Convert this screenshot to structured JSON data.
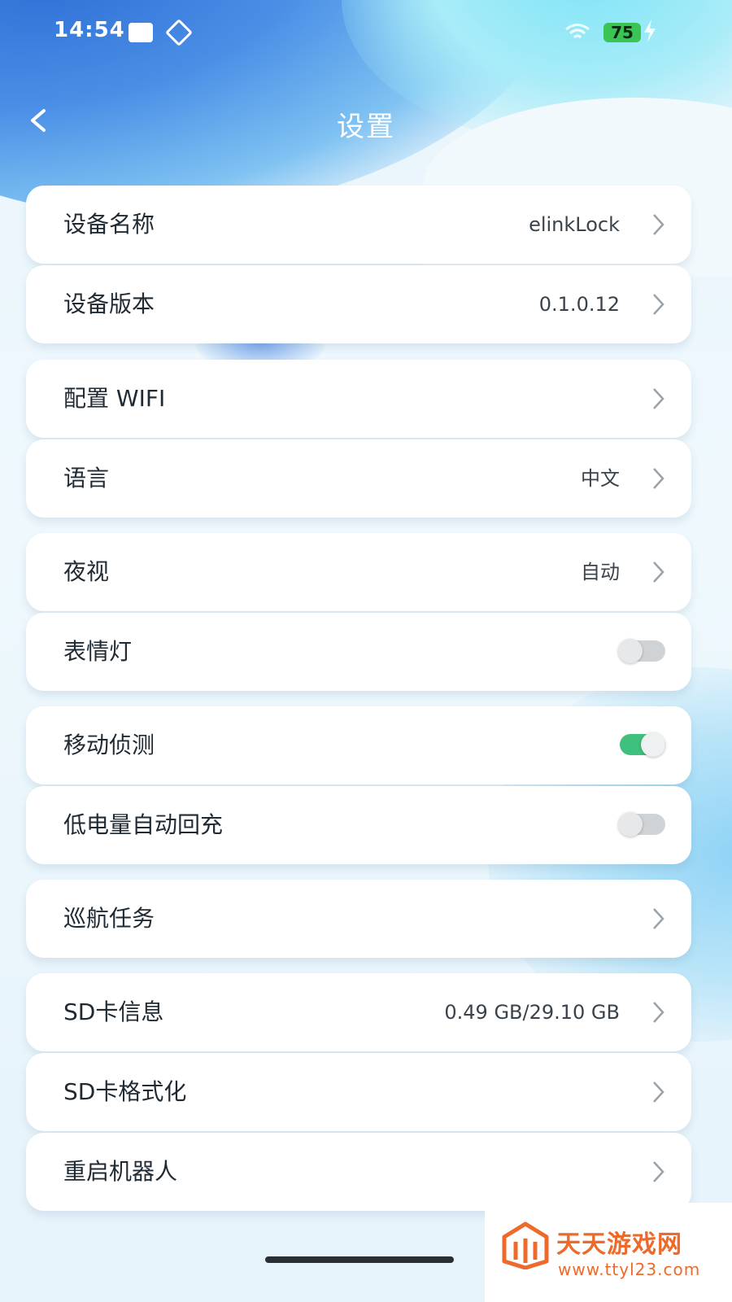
{
  "status_bar": {
    "time": "14:54",
    "battery": "75"
  },
  "header": {
    "title": "设置"
  },
  "rows": [
    {
      "label": "设备名称",
      "value": "elinkLock"
    },
    {
      "label": "设备版本",
      "value": "0.1.0.12"
    },
    {
      "label": "配置 WIFI"
    },
    {
      "label": "语言",
      "value": "中文"
    },
    {
      "label": "夜视",
      "value": "自动"
    },
    {
      "label": "表情灯",
      "toggle": false
    },
    {
      "label": "移动侦测",
      "toggle": true
    },
    {
      "label": "低电量自动回充",
      "toggle": false
    },
    {
      "label": "巡航任务"
    },
    {
      "label": "SD卡信息",
      "value": "0.49 GB/29.10 GB"
    },
    {
      "label": "SD卡格式化"
    },
    {
      "label": "重启机器人"
    }
  ],
  "watermark": {
    "name": "天天游戏网",
    "url": "www.ttyl23.com"
  },
  "colors": {
    "toggle_on": "#3fc07d",
    "toggle_off": "#cfd3d6",
    "watermark": "#ee6a2a"
  }
}
